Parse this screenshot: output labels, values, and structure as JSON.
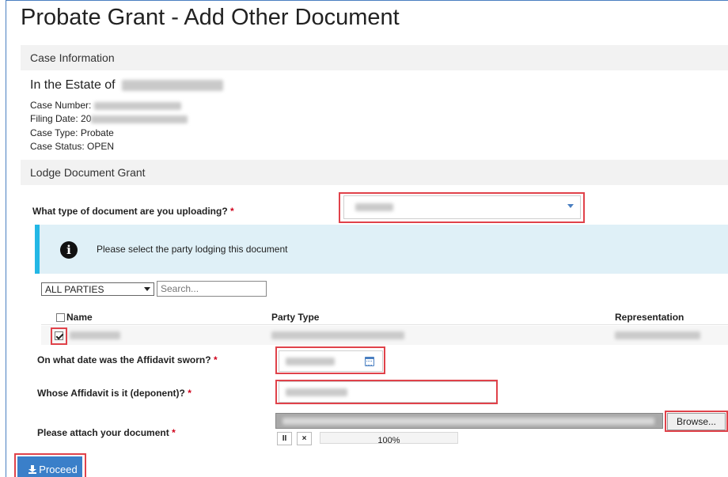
{
  "page": {
    "title": "Probate Grant - Add Other Document"
  },
  "case_info": {
    "header": "Case Information",
    "estate_prefix": "In the Estate of",
    "case_number_label": "Case Number:",
    "filing_date_label": "Filing Date: 20",
    "case_type_label": "Case Type: Probate",
    "case_status_label": "Case Status: OPEN"
  },
  "lodge": {
    "header": "Lodge Document Grant",
    "doc_type_label": "What type of document are you uploading?",
    "required_mark": "*"
  },
  "party_panel": {
    "info_icon_glyph": "i",
    "info_text": "Please select the party lodging this document",
    "party_filter_value": "ALL PARTIES",
    "search_placeholder": "Search...",
    "columns": {
      "name": "Name",
      "party_type": "Party Type",
      "representation": "Representation"
    }
  },
  "affidavit": {
    "date_label": "On what date was the Affidavit sworn?",
    "deponent_label": "Whose Affidavit is it (deponent)?",
    "attach_label": "Please attach your document",
    "browse_label": "Browse...",
    "pause_glyph": "II",
    "cancel_glyph": "×",
    "upload_progress_text": "100%",
    "upload_progress": 1.0
  },
  "actions": {
    "proceed_label": "Proceed"
  },
  "colors": {
    "accent": "#3a7fc9",
    "highlight": "#e0424a",
    "info_border": "#23b7e5",
    "required": "#d0021b"
  }
}
